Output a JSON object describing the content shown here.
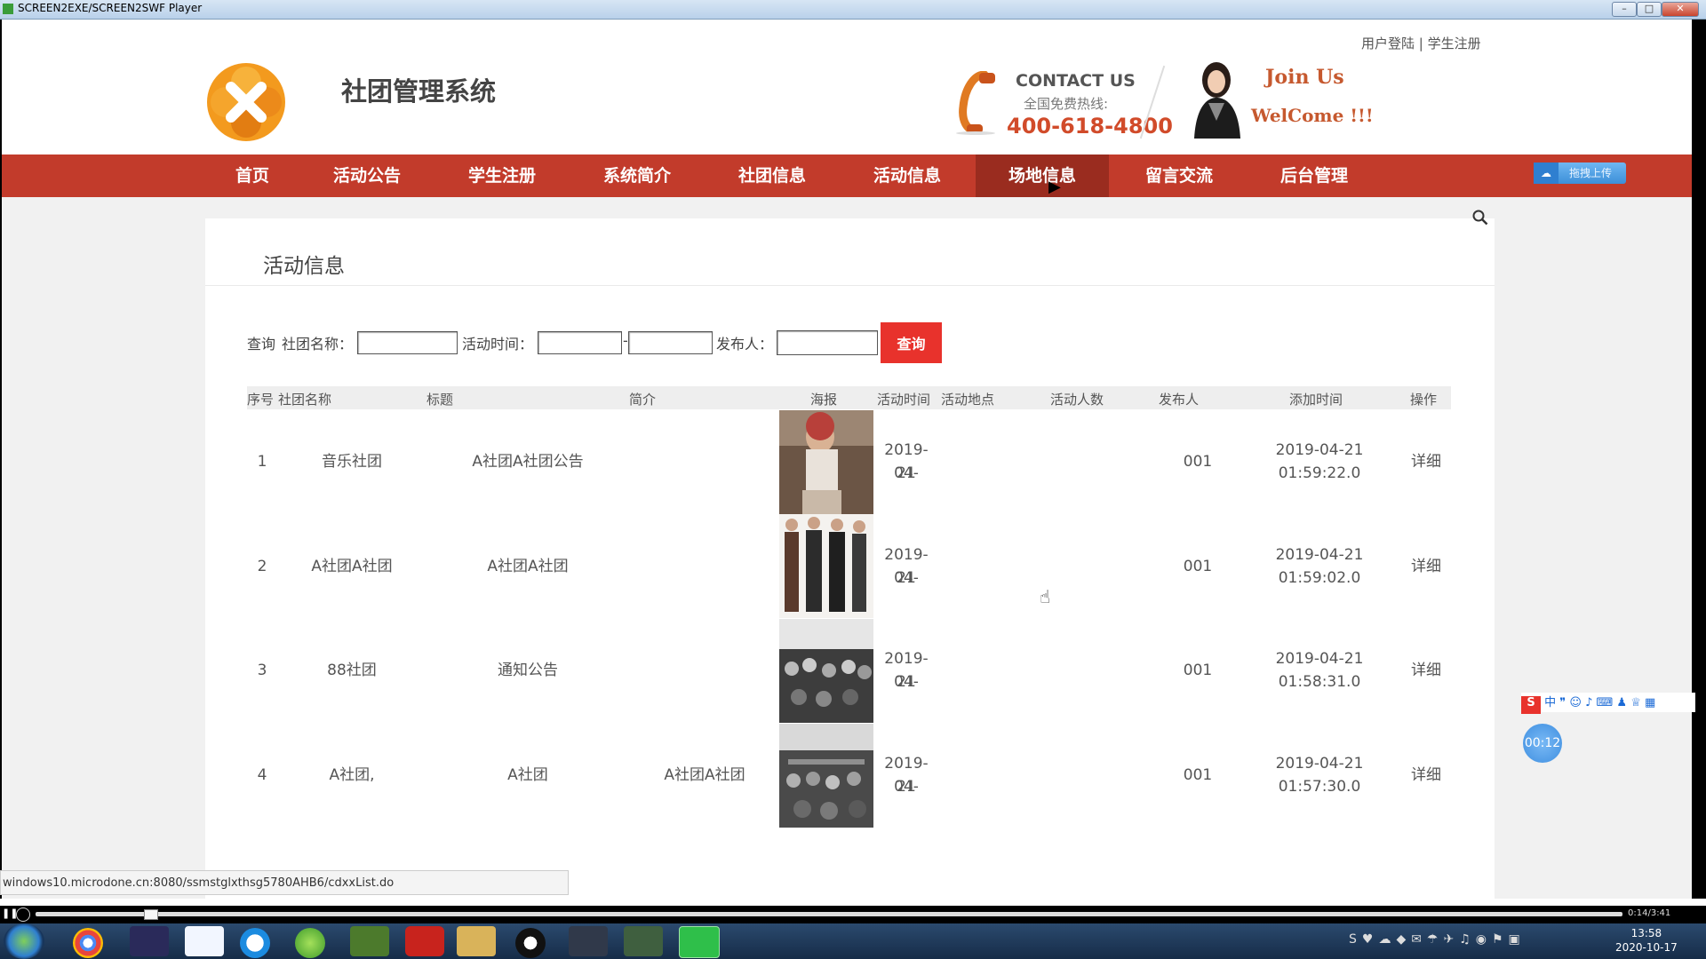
{
  "window": {
    "title": "SCREEN2EXE/SCREEN2SWF Player",
    "minimize": "–",
    "maximize": "□",
    "close": "✕"
  },
  "header": {
    "login_link": "用户登陆",
    "separator": "|",
    "register_link": "学生注册",
    "system_name": "社团管理系统",
    "contact_title": "CONTACT US",
    "contact_sub": "全国免费热线:",
    "contact_phone": "400-618-4800",
    "join_line1": "Join Us",
    "join_line2": "WelCome !!!"
  },
  "nav": {
    "items": [
      {
        "label": "首页"
      },
      {
        "label": "活动公告"
      },
      {
        "label": "学生注册"
      },
      {
        "label": "系统简介"
      },
      {
        "label": "社团信息"
      },
      {
        "label": "活动信息"
      },
      {
        "label": "场地信息"
      },
      {
        "label": "留言交流"
      },
      {
        "label": "后台管理"
      }
    ],
    "active": "场地信息",
    "upload_label": "拖拽上传"
  },
  "page": {
    "title": "活动信息"
  },
  "search": {
    "label_query": "查询",
    "label_club": "社团名称：",
    "label_time": "活动时间：",
    "label_dash": "-",
    "label_publisher": "发布人：",
    "button": "查询"
  },
  "table": {
    "headers": [
      "序号",
      "社团名称",
      "标题",
      "简介",
      "海报",
      "活动时间",
      "活动地点",
      "活动人数",
      "发布人",
      "添加时间",
      "操作"
    ],
    "rows": [
      {
        "no": "1",
        "club": "音乐社团",
        "title": "A社团A社团公告",
        "intro": "",
        "date_a": "2019-04-",
        "date_b": "21",
        "place": "",
        "count": "",
        "publisher": "001",
        "added_a": "2019-04-21",
        "added_b": "01:59:22.0",
        "action": "详细"
      },
      {
        "no": "2",
        "club": "A社团A社团",
        "title": "A社团A社团",
        "intro": "",
        "date_a": "2019-04-",
        "date_b": "21",
        "place": "",
        "count": "",
        "publisher": "001",
        "added_a": "2019-04-21",
        "added_b": "01:59:02.0",
        "action": "详细"
      },
      {
        "no": "3",
        "club": "88社团",
        "title": "通知公告",
        "intro": "",
        "date_a": "2019-04-",
        "date_b": "21",
        "place": "",
        "count": "",
        "publisher": "001",
        "added_a": "2019-04-21",
        "added_b": "01:58:31.0",
        "action": "详细"
      },
      {
        "no": "4",
        "club": "A社团,",
        "title": "A社团",
        "intro": "A社团A社团",
        "date_a": "2019-04-",
        "date_b": "21",
        "place": "",
        "count": "",
        "publisher": "001",
        "added_a": "2019-04-21",
        "added_b": "01:57:30.0",
        "action": "详细"
      }
    ]
  },
  "statusbar": {
    "url": "windows10.microdone.cn:8080/ssmstglxthsg5780AHB6/cdxxList.do"
  },
  "player": {
    "time": "0:14/3:41"
  },
  "overlay": {
    "timer": "00:12",
    "ime_mode": "中"
  },
  "taskbar": {
    "time": "13:58",
    "date": "2020-10-17"
  },
  "colors": {
    "nav": "#c23b2b",
    "nav_active": "#9a2c1f",
    "query_button": "#e8322c",
    "accent_orange": "#d14b2a"
  }
}
